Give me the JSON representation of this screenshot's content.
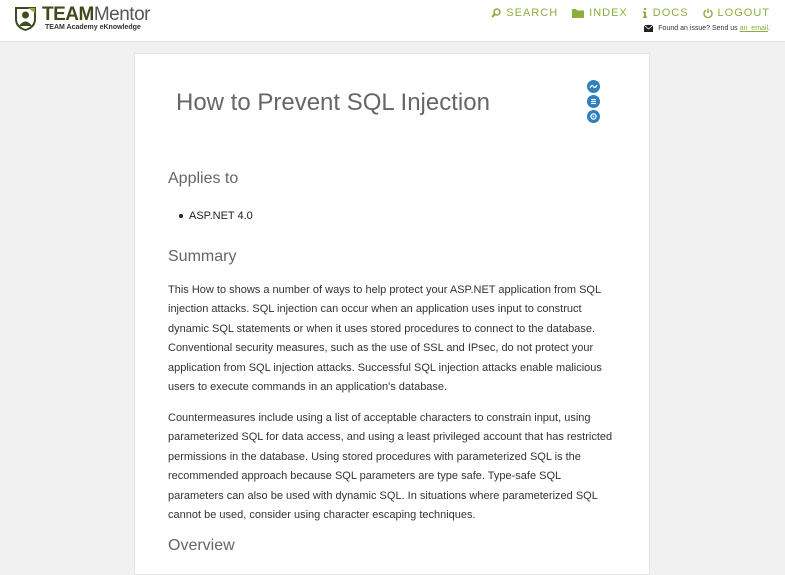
{
  "header": {
    "logo_team": "TEAM",
    "logo_mentor": "Mentor",
    "logo_tagline": "TEAM Academy eKnowledge",
    "nav": [
      {
        "label": "SEARCH",
        "icon": "search-icon"
      },
      {
        "label": "INDEX",
        "icon": "folder-icon"
      },
      {
        "label": "DOCS",
        "icon": "info-icon"
      },
      {
        "label": "LOGOUT",
        "icon": "power-icon"
      }
    ],
    "issue_text": "Found an issue? Send us",
    "issue_link": "an_email",
    "issue_end": "."
  },
  "article": {
    "title": "How to Prevent SQL Injection",
    "side_icons": [
      "share-icon",
      "list-icon",
      "settings-icon"
    ],
    "applies_heading": "Applies to",
    "applies_items": [
      "ASP.NET 4.0"
    ],
    "summary_heading": "Summary",
    "summary_p1": "This How to shows a number of ways to help protect your ASP.NET application from SQL injection attacks. SQL injection can occur when an application uses input to construct dynamic SQL statements or when it uses stored procedures to connect to the database. Conventional security measures, such as the use of SSL and IPsec, do not protect your application from SQL injection attacks. Successful SQL injection attacks enable malicious users to execute commands in an application's database.",
    "summary_p2": "Countermeasures include using a list of acceptable characters to constrain input, using parameterized SQL for data access, and using a least privileged account that has restricted permissions in the database. Using stored procedures with parameterized SQL is the recommended approach because SQL parameters are type safe. Type-safe SQL parameters can also be used with dynamic SQL. In situations where parameterized SQL cannot be used, consider using character escaping techniques.",
    "overview_heading": "Overview"
  },
  "colors": {
    "accent": "#8cae3e",
    "icon_blue": "#2f7fbf",
    "logo_dark": "#3f4a1e"
  }
}
